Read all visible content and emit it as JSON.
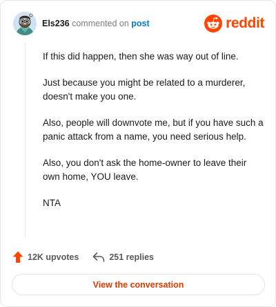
{
  "header": {
    "username": "Els236",
    "action_text": "commented on",
    "target_link": "post",
    "brand": "reddit"
  },
  "comment": {
    "paragraphs": [
      "If this did happen, then she was way out of line.",
      "Just because you might be related to a murderer, doesn't make you one.",
      "Also, people will downvote me, but if you have such a panic attack from a name, you need serious help.",
      "Also, you don't ask the home-owner to leave their own home, YOU leave.",
      "NTA"
    ]
  },
  "actions": {
    "upvotes": "12K upvotes",
    "replies": "251 replies"
  },
  "cta": {
    "label": "View the conversation"
  },
  "colors": {
    "brand": "#ff4500",
    "link": "#0079d3",
    "cta_text": "#d93a00"
  },
  "icons": {
    "avatar": "snoo-avatar",
    "brand": "reddit-logo-icon",
    "upvote": "upvote-arrow-icon",
    "reply": "reply-arrow-icon"
  }
}
